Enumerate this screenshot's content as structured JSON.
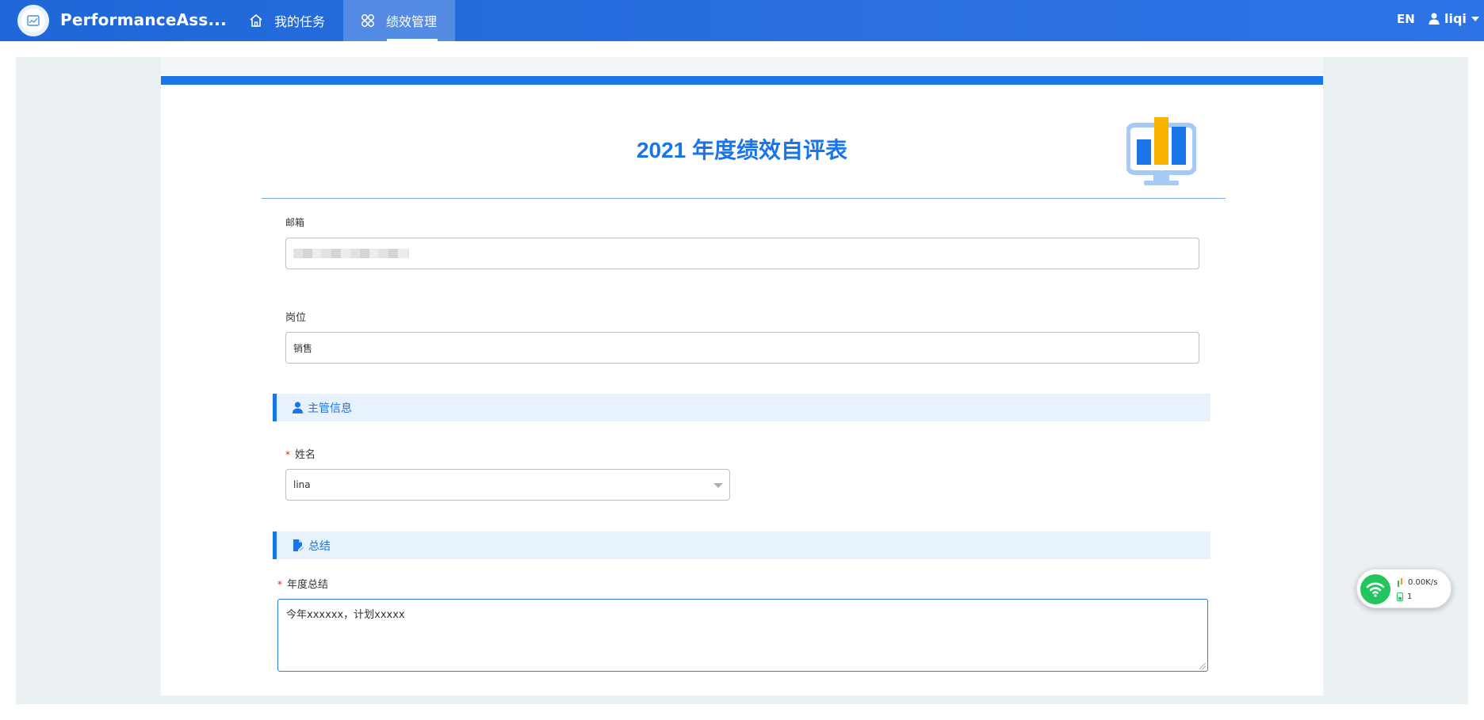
{
  "app": {
    "title": "PerformanceAss..."
  },
  "nav": {
    "tasks_label": "我的任务",
    "performance_label": "绩效管理"
  },
  "header_right": {
    "lang": "EN",
    "username": "liqi"
  },
  "form": {
    "title": "2021 年度绩效自评表",
    "email_label": "邮箱",
    "position_label": "岗位",
    "position_value": "销售",
    "supervisor_section": "主管信息",
    "name_label": "姓名",
    "name_value": "lina",
    "summary_section": "总结",
    "annual_summary_label": "年度总结",
    "annual_summary_value": "今年xxxxxx，计划xxxxx"
  },
  "network_widget": {
    "speed": "0.00K/s",
    "count": "1"
  },
  "colors": {
    "topbar": "#2b6fe0",
    "accent": "#1a76e8",
    "section_bg": "#e8f2fd",
    "page_bg": "#ebf0f3",
    "required": "#e0241b",
    "network_ok": "#22c55e"
  }
}
